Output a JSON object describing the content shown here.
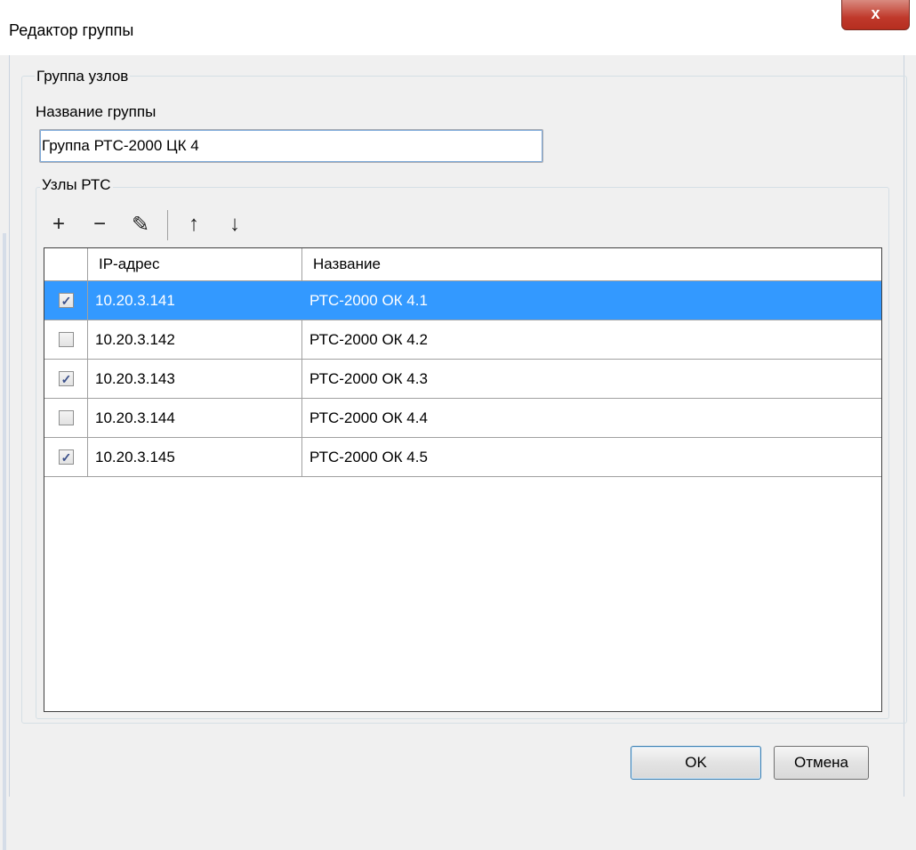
{
  "window": {
    "title": "Редактор группы",
    "close_label": "x"
  },
  "group": {
    "legend": "Группа узлов",
    "name_label": "Название группы",
    "name_value": "Группа РТС-2000 ЦК 4"
  },
  "nodes": {
    "legend": "Узлы РТС",
    "toolbar": {
      "add": "+",
      "remove": "−",
      "edit": "✎",
      "up": "↑",
      "down": "↓"
    },
    "columns": [
      "IP-адрес",
      "Название"
    ],
    "rows": [
      {
        "checked": true,
        "ip": "10.20.3.141",
        "name": "РТС-2000 ОК 4.1",
        "selected": true
      },
      {
        "checked": false,
        "ip": "10.20.3.142",
        "name": "РТС-2000 ОК 4.2",
        "selected": false
      },
      {
        "checked": true,
        "ip": "10.20.3.143",
        "name": "РТС-2000 ОК 4.3",
        "selected": false
      },
      {
        "checked": false,
        "ip": "10.20.3.144",
        "name": "РТС-2000 ОК 4.4",
        "selected": false
      },
      {
        "checked": true,
        "ip": "10.20.3.145",
        "name": "РТС-2000 ОК 4.5",
        "selected": false
      }
    ]
  },
  "buttons": {
    "ok": "OK",
    "cancel": "Отмена"
  },
  "colors": {
    "selection": "#3399ff",
    "close_button": "#c0392b"
  }
}
